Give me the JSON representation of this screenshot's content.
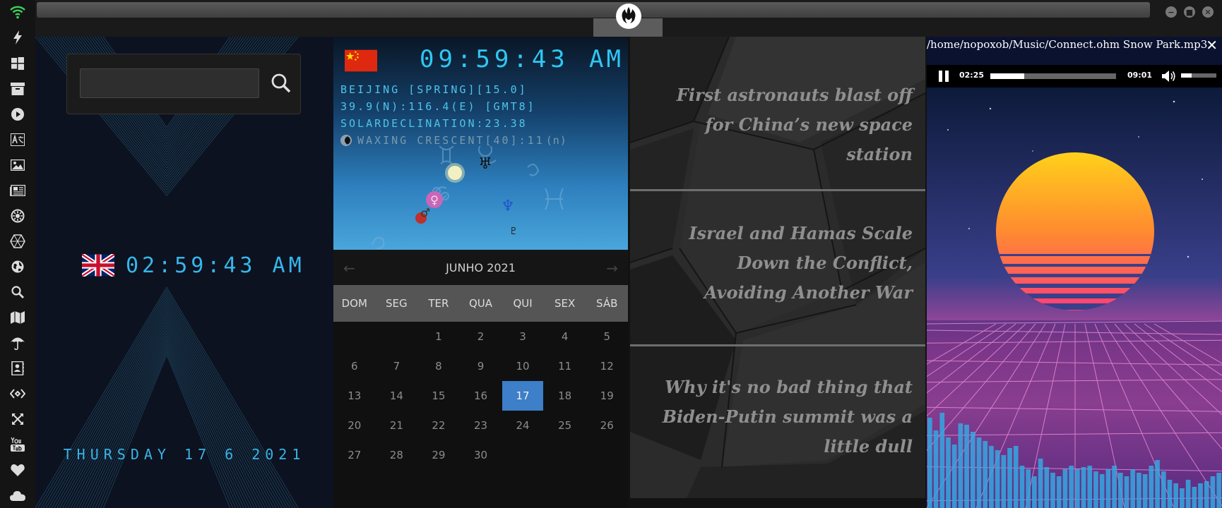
{
  "sidebar": {
    "icons": [
      "wifi-icon",
      "lightning-icon",
      "windows-icon",
      "archive-icon",
      "play-icon",
      "translate-icon",
      "image-icon",
      "news-icon",
      "settings-gear-icon",
      "hexagon-icon",
      "globe-icon",
      "search-icon",
      "map-icon",
      "umbrella-icon",
      "contacts-icon",
      "code-icon",
      "expand-icon",
      "youtube-icon",
      "heart-icon",
      "cloud-icon"
    ]
  },
  "window_controls": {
    "minimize": "−",
    "maximize": "■",
    "close": "✕"
  },
  "search": {
    "value": ""
  },
  "uk_clock": {
    "time": "02:59:43 AM",
    "date": "THURSDAY 17 6 2021"
  },
  "astro": {
    "time": "09:59:43",
    "ampm": "AM",
    "location_line": "BEIJING [SPRING][15.0]",
    "coords_line": "39.9(N):116.4(E) [GMT8]",
    "declination_line": "SOLARDECLINATION:23.38",
    "moon_line": "WAXING CRESCENT[40]:11",
    "moon_suffix": "(n)",
    "planet_symbols": {
      "uranus": "♅",
      "venus": "♀",
      "mars": "♂",
      "neptune": "♆",
      "other": "♇"
    },
    "colors": {
      "digit": "#2ec7f2",
      "venus": "#c966b8",
      "mars": "#c0302a",
      "neptune": "#2255cc"
    }
  },
  "calendar": {
    "month_label": "JUNHO 2021",
    "prev": "←",
    "next": "→",
    "day_names": [
      "DOM",
      "SEG",
      "TER",
      "QUA",
      "QUI",
      "SEX",
      "SÁB"
    ],
    "leading_blanks": 2,
    "days_in_month": 30,
    "today": 17,
    "today_color": "#3d7fc8"
  },
  "news": {
    "items": [
      "First astronauts blast off for China’s new space station",
      "Israel and Hamas Scale Down the Conflict, Avoiding Another War",
      "Why it's no bad thing that Biden-Putin summit was a little dull"
    ]
  },
  "player": {
    "path": "/home/nopoxob/Music/Connect.ohm Snow Park.mp3",
    "close": "✕",
    "current_time": "02:25",
    "duration": "09:01",
    "progress_fraction": 0.27,
    "volume_fraction": 0.3,
    "visualizer_color": "#35a8e0"
  }
}
